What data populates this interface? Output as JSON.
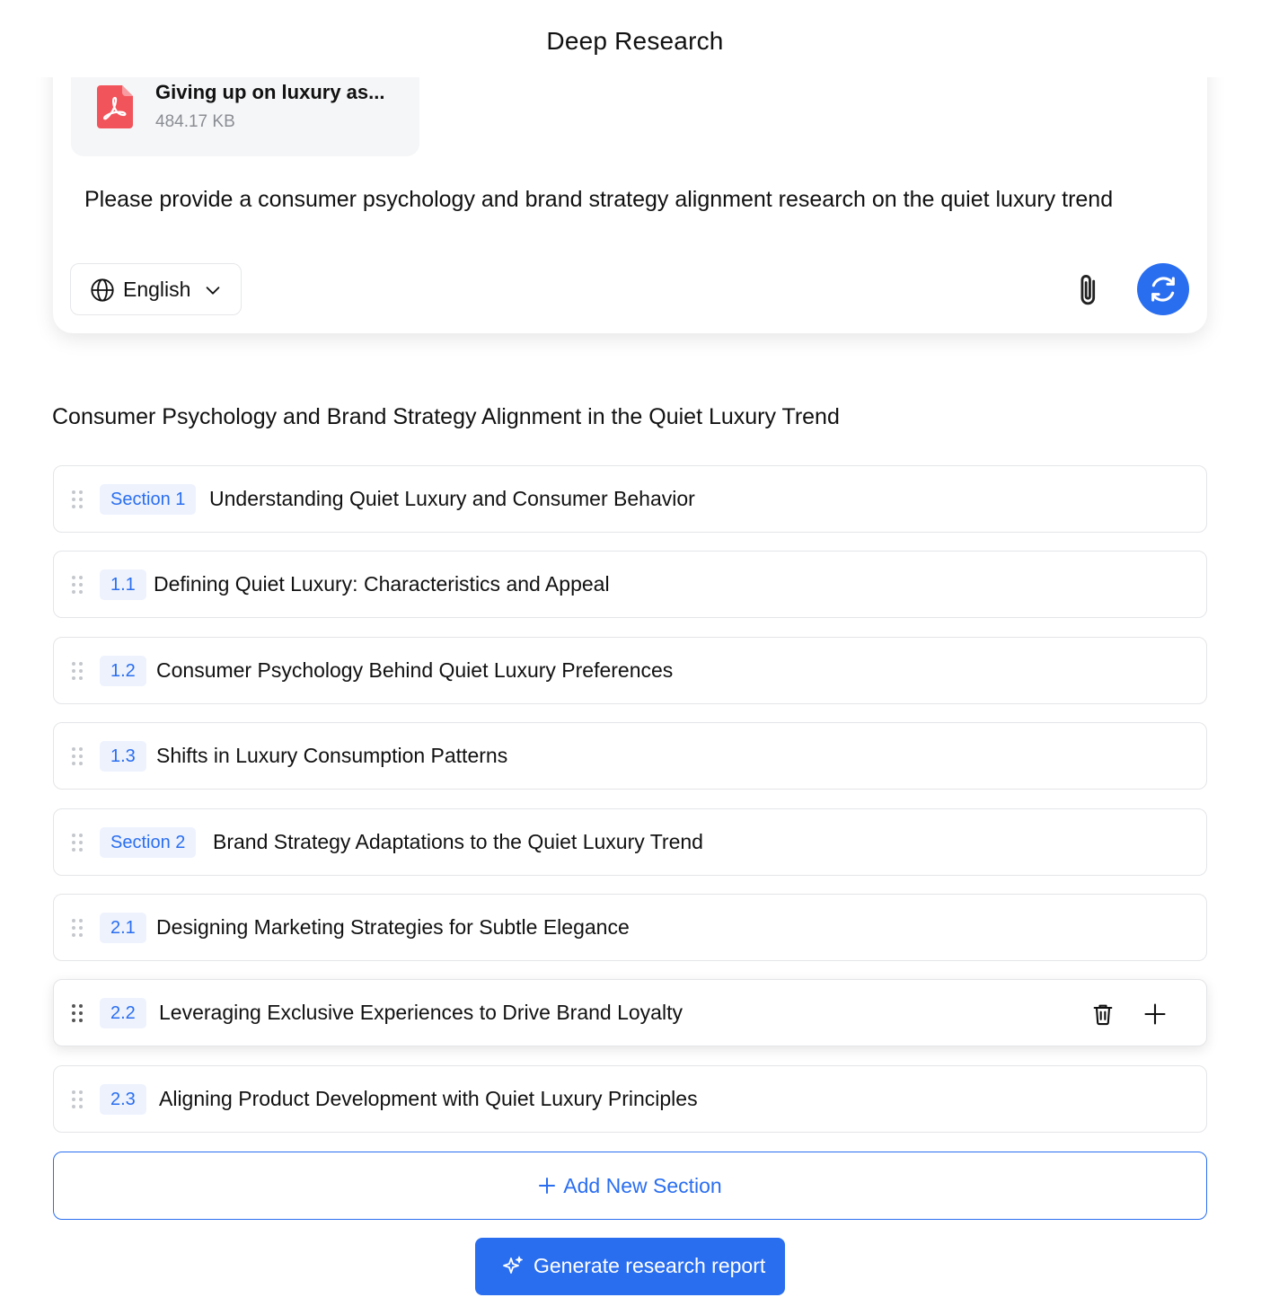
{
  "header": {
    "title": "Deep Research"
  },
  "input": {
    "file": {
      "name": "Giving up on luxury as...",
      "size": "484.17 KB"
    },
    "prompt": "Please provide a consumer psychology and brand strategy alignment research on the quiet luxury trend",
    "language": "English"
  },
  "outline": {
    "title": "Consumer Psychology and Brand Strategy Alignment in the Quiet Luxury Trend",
    "rows": [
      {
        "badge": "Section 1",
        "title": "Understanding Quiet Luxury and Consumer Behavior"
      },
      {
        "badge": "1.1",
        "title": "Defining Quiet Luxury: Characteristics and Appeal"
      },
      {
        "badge": "1.2",
        "title": "Consumer Psychology Behind Quiet Luxury Preferences"
      },
      {
        "badge": "1.3",
        "title": "Shifts in Luxury Consumption Patterns"
      },
      {
        "badge": "Section 2",
        "title": "Brand Strategy Adaptations to the Quiet Luxury Trend"
      },
      {
        "badge": "2.1",
        "title": "Designing Marketing Strategies for Subtle Elegance"
      },
      {
        "badge": "2.2",
        "title": "Leveraging Exclusive Experiences to Drive Brand Loyalty"
      },
      {
        "badge": "2.3",
        "title": "Aligning Product Development with Quiet Luxury Principles"
      }
    ]
  },
  "actions": {
    "add_section": "Add New Section",
    "generate": "Generate research report"
  },
  "colors": {
    "accent": "#2a6ef0",
    "badge_bg": "#edf2fd",
    "pdf": "#f2545b"
  }
}
